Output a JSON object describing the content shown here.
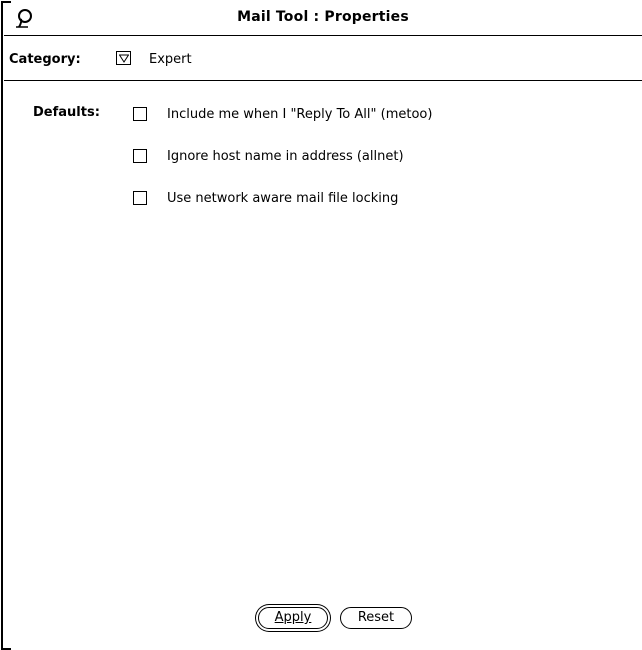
{
  "window": {
    "title": "Mail Tool : Properties",
    "icon": "window-menu-icon"
  },
  "category": {
    "label": "Category:",
    "value": "Expert",
    "menu_icon": "chevron-down-icon"
  },
  "defaults": {
    "label": "Defaults:",
    "options": [
      {
        "label": "Include me when I \"Reply To All\" (metoo)",
        "checked": false
      },
      {
        "label": "Ignore host name in address (allnet)",
        "checked": false
      },
      {
        "label": "Use network aware mail file locking",
        "checked": false
      }
    ]
  },
  "buttons": {
    "apply_label": "Apply",
    "reset_label": "Reset"
  }
}
